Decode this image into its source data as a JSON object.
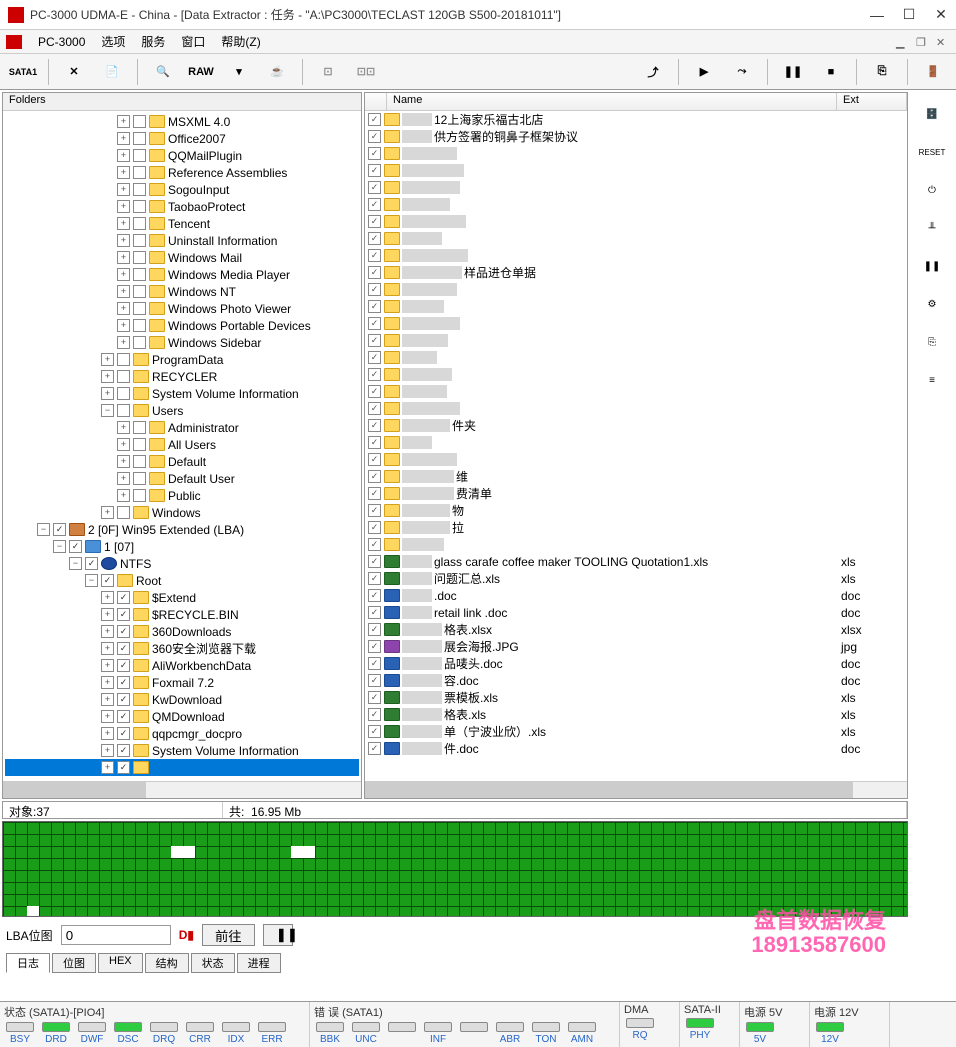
{
  "titlebar": {
    "title": "PC-3000 UDMA-E - China - [Data Extractor : 任务 - \"A:\\PC3000\\TECLAST 120GB S500-20181011\"]"
  },
  "menubar": {
    "items": [
      "PC-3000",
      "选项",
      "服务",
      "窗口",
      "帮助(Z)"
    ]
  },
  "toolbar": {
    "sata_label": "SATA1",
    "raw_label": "RAW"
  },
  "left_panel": {
    "header": "Folders",
    "tree": [
      {
        "indent": 7,
        "exp": "+",
        "chk": false,
        "icon": "folder",
        "label": "MSXML 4.0"
      },
      {
        "indent": 7,
        "exp": "+",
        "chk": false,
        "icon": "folder",
        "label": "Office2007"
      },
      {
        "indent": 7,
        "exp": "+",
        "chk": false,
        "icon": "folder",
        "label": "QQMailPlugin"
      },
      {
        "indent": 7,
        "exp": "+",
        "chk": false,
        "icon": "folder",
        "label": "Reference Assemblies"
      },
      {
        "indent": 7,
        "exp": "+",
        "chk": false,
        "icon": "folder",
        "label": "SogouInput"
      },
      {
        "indent": 7,
        "exp": "+",
        "chk": false,
        "icon": "folder",
        "label": "TaobaoProtect"
      },
      {
        "indent": 7,
        "exp": "+",
        "chk": false,
        "icon": "folder",
        "label": "Tencent"
      },
      {
        "indent": 7,
        "exp": "+",
        "chk": false,
        "icon": "folder",
        "label": "Uninstall Information"
      },
      {
        "indent": 7,
        "exp": "+",
        "chk": false,
        "icon": "folder",
        "label": "Windows Mail"
      },
      {
        "indent": 7,
        "exp": "+",
        "chk": false,
        "icon": "folder",
        "label": "Windows Media Player"
      },
      {
        "indent": 7,
        "exp": "+",
        "chk": false,
        "icon": "folder",
        "label": "Windows NT"
      },
      {
        "indent": 7,
        "exp": "+",
        "chk": false,
        "icon": "folder",
        "label": "Windows Photo Viewer"
      },
      {
        "indent": 7,
        "exp": "+",
        "chk": false,
        "icon": "folder",
        "label": "Windows Portable Devices"
      },
      {
        "indent": 7,
        "exp": "+",
        "chk": false,
        "icon": "folder",
        "label": "Windows Sidebar"
      },
      {
        "indent": 6,
        "exp": "+",
        "chk": false,
        "icon": "folder",
        "label": "ProgramData"
      },
      {
        "indent": 6,
        "exp": "+",
        "chk": false,
        "icon": "folder",
        "label": "RECYCLER"
      },
      {
        "indent": 6,
        "exp": "+",
        "chk": false,
        "icon": "folder",
        "label": "System Volume Information"
      },
      {
        "indent": 6,
        "exp": "−",
        "chk": false,
        "icon": "folder",
        "label": "Users"
      },
      {
        "indent": 7,
        "exp": "+",
        "chk": false,
        "icon": "folder",
        "label": "Administrator"
      },
      {
        "indent": 7,
        "exp": "+",
        "chk": false,
        "icon": "folder",
        "label": "All Users"
      },
      {
        "indent": 7,
        "exp": "+",
        "chk": false,
        "icon": "folder",
        "label": "Default"
      },
      {
        "indent": 7,
        "exp": "+",
        "chk": false,
        "icon": "folder",
        "label": "Default User"
      },
      {
        "indent": 7,
        "exp": "+",
        "chk": false,
        "icon": "folder",
        "label": "Public"
      },
      {
        "indent": 6,
        "exp": "+",
        "chk": false,
        "icon": "folder",
        "label": "Windows"
      },
      {
        "indent": 2,
        "exp": "−",
        "chk": true,
        "icon": "red",
        "label": "2 [0F] Win95 Extended  (LBA)"
      },
      {
        "indent": 3,
        "exp": "−",
        "chk": true,
        "icon": "blue",
        "label": "1 [07]"
      },
      {
        "indent": 4,
        "exp": "−",
        "chk": true,
        "icon": "ntfs",
        "label": "NTFS"
      },
      {
        "indent": 5,
        "exp": "−",
        "chk": true,
        "icon": "root",
        "label": "Root"
      },
      {
        "indent": 6,
        "exp": "+",
        "chk": true,
        "icon": "folder",
        "label": "$Extend"
      },
      {
        "indent": 6,
        "exp": "+",
        "chk": true,
        "icon": "folder",
        "label": "$RECYCLE.BIN"
      },
      {
        "indent": 6,
        "exp": "+",
        "chk": true,
        "icon": "folder",
        "label": "360Downloads"
      },
      {
        "indent": 6,
        "exp": "+",
        "chk": true,
        "icon": "folder",
        "label": "360安全浏览器下载"
      },
      {
        "indent": 6,
        "exp": "+",
        "chk": true,
        "icon": "folder",
        "label": "AliWorkbenchData"
      },
      {
        "indent": 6,
        "exp": "+",
        "chk": true,
        "icon": "folder",
        "label": "Foxmail 7.2"
      },
      {
        "indent": 6,
        "exp": "+",
        "chk": true,
        "icon": "folder",
        "label": "KwDownload"
      },
      {
        "indent": 6,
        "exp": "+",
        "chk": true,
        "icon": "folder",
        "label": "QMDownload"
      },
      {
        "indent": 6,
        "exp": "+",
        "chk": true,
        "icon": "folder",
        "label": "qqpcmgr_docpro"
      },
      {
        "indent": 6,
        "exp": "+",
        "chk": true,
        "icon": "folder",
        "label": "System Volume Information"
      },
      {
        "indent": 6,
        "exp": "+",
        "chk": true,
        "icon": "folder",
        "label": "",
        "selected": true,
        "blur": 60
      }
    ]
  },
  "right_panel": {
    "columns": {
      "name": "Name",
      "ext": "Ext"
    },
    "rows": [
      {
        "icon": "folder",
        "blur": 30,
        "name": "12上海家乐福古北店",
        "ext": ""
      },
      {
        "icon": "folder",
        "blur": 30,
        "name": "供方签署的铜鼻子框架协议",
        "ext": ""
      },
      {
        "icon": "folder",
        "blur": 55,
        "name": "",
        "ext": ""
      },
      {
        "icon": "folder",
        "blur": 62,
        "name": "",
        "ext": ""
      },
      {
        "icon": "folder",
        "blur": 58,
        "name": "",
        "ext": ""
      },
      {
        "icon": "folder",
        "blur": 48,
        "name": "",
        "ext": ""
      },
      {
        "icon": "folder",
        "blur": 64,
        "name": "",
        "ext": ""
      },
      {
        "icon": "folder",
        "blur": 40,
        "name": "",
        "ext": ""
      },
      {
        "icon": "folder",
        "blur": 66,
        "name": "",
        "ext": ""
      },
      {
        "icon": "folder",
        "blur": 60,
        "name": "样品进仓单据",
        "ext": ""
      },
      {
        "icon": "folder",
        "blur": 55,
        "name": "",
        "ext": ""
      },
      {
        "icon": "folder",
        "blur": 42,
        "name": "",
        "ext": ""
      },
      {
        "icon": "folder",
        "blur": 58,
        "name": "",
        "ext": ""
      },
      {
        "icon": "folder",
        "blur": 46,
        "name": "",
        "ext": ""
      },
      {
        "icon": "folder",
        "blur": 35,
        "name": "",
        "ext": ""
      },
      {
        "icon": "folder",
        "blur": 50,
        "name": "",
        "ext": ""
      },
      {
        "icon": "folder",
        "blur": 45,
        "name": "",
        "ext": ""
      },
      {
        "icon": "folder",
        "blur": 58,
        "name": "",
        "ext": ""
      },
      {
        "icon": "folder",
        "blur": 48,
        "name": "件夹",
        "ext": ""
      },
      {
        "icon": "folder",
        "blur": 30,
        "name": "",
        "ext": ""
      },
      {
        "icon": "folder",
        "blur": 55,
        "name": "",
        "ext": ""
      },
      {
        "icon": "folder",
        "blur": 52,
        "name": "维",
        "ext": ""
      },
      {
        "icon": "folder",
        "blur": 52,
        "name": "费清单",
        "ext": ""
      },
      {
        "icon": "folder",
        "blur": 48,
        "name": "物",
        "ext": ""
      },
      {
        "icon": "folder",
        "blur": 48,
        "name": "拉",
        "ext": ""
      },
      {
        "icon": "folder",
        "blur": 42,
        "name": "",
        "ext": ""
      },
      {
        "icon": "xls",
        "blur": 30,
        "name": "glass carafe coffee maker TOOLING Quotation1.xls",
        "ext": "xls"
      },
      {
        "icon": "xls",
        "blur": 30,
        "name": "问题汇总.xls",
        "ext": "xls"
      },
      {
        "icon": "doc",
        "blur": 30,
        "name": ".doc",
        "ext": "doc"
      },
      {
        "icon": "doc",
        "blur": 30,
        "name": " retail link .doc",
        "ext": "doc"
      },
      {
        "icon": "xls",
        "blur": 40,
        "name": "格表.xlsx",
        "ext": "xlsx"
      },
      {
        "icon": "jpg",
        "blur": 40,
        "name": "展会海报.JPG",
        "ext": "jpg"
      },
      {
        "icon": "doc",
        "blur": 40,
        "name": "品唛头.doc",
        "ext": "doc"
      },
      {
        "icon": "doc",
        "blur": 40,
        "name": "容.doc",
        "ext": "doc"
      },
      {
        "icon": "xls",
        "blur": 40,
        "name": "票模板.xls",
        "ext": "xls"
      },
      {
        "icon": "xls",
        "blur": 40,
        "name": "格表.xls",
        "ext": "xls"
      },
      {
        "icon": "xls",
        "blur": 40,
        "name": "单（宁波业欣）.xls",
        "ext": "xls"
      },
      {
        "icon": "doc",
        "blur": 40,
        "name": "件.doc",
        "ext": "doc"
      }
    ]
  },
  "mid_status": {
    "objects_label": "对象:37",
    "total_label": "共:",
    "total_value": "16.95 Mb"
  },
  "lba": {
    "label": "LBA位图",
    "value": "0",
    "go_btn": "前往"
  },
  "tabs": [
    "日志",
    "位图",
    "HEX",
    "结构",
    "状态",
    "进程"
  ],
  "side_reset": "RESET",
  "bottom": {
    "group1": {
      "title": "状态 (SATA1)-[PIO4]",
      "leds": [
        {
          "label": "BSY",
          "on": false
        },
        {
          "label": "DRD",
          "on": true
        },
        {
          "label": "DWF",
          "on": false
        },
        {
          "label": "DSC",
          "on": true
        },
        {
          "label": "DRQ",
          "on": false
        },
        {
          "label": "CRR",
          "on": false
        },
        {
          "label": "IDX",
          "on": false
        },
        {
          "label": "ERR",
          "on": false
        }
      ]
    },
    "group2": {
      "title": "错 误 (SATA1)",
      "leds": [
        {
          "label": "BBK",
          "on": false
        },
        {
          "label": "UNC",
          "on": false
        },
        {
          "label": "",
          "on": false
        },
        {
          "label": "INF",
          "on": false
        },
        {
          "label": "",
          "on": false
        },
        {
          "label": "ABR",
          "on": false
        },
        {
          "label": "TON",
          "on": false
        },
        {
          "label": "AMN",
          "on": false
        }
      ]
    },
    "group3": {
      "title": "DMA",
      "leds": [
        {
          "label": "RQ",
          "on": false
        }
      ]
    },
    "group4": {
      "title": "SATA-II",
      "leds": [
        {
          "label": "PHY",
          "on": true
        }
      ]
    },
    "group5": {
      "title": "电源 5V",
      "leds": [
        {
          "label": "5V",
          "on": true
        }
      ]
    },
    "group6": {
      "title": "电源 12V",
      "leds": [
        {
          "label": "12V",
          "on": true
        }
      ]
    }
  },
  "watermark": {
    "line1": "盘首数据恢复",
    "line2": "18913587600"
  }
}
